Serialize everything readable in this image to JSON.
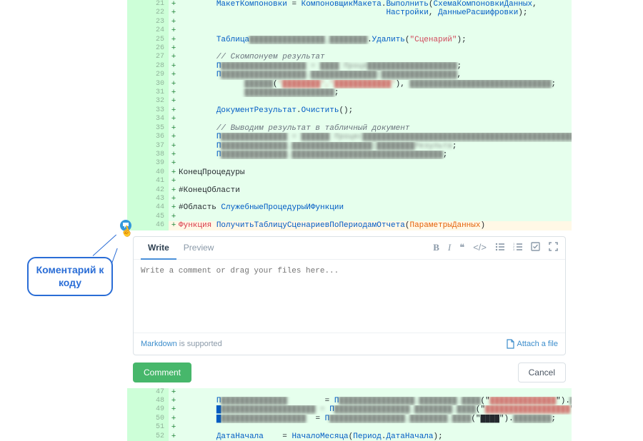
{
  "codeLines": [
    {
      "ln": 21,
      "indent": "        ",
      "tokens": [
        {
          "t": "МакетКомпоновки ",
          "c": "fn"
        },
        {
          "t": "= ",
          "c": ""
        },
        {
          "t": "КомпоновщикМакета",
          "c": "fn"
        },
        {
          "t": ".",
          "c": ""
        },
        {
          "t": "Выполнить",
          "c": "fn"
        },
        {
          "t": "(",
          "c": ""
        },
        {
          "t": "СхемаКомпоновкиДанных",
          "c": "fn"
        },
        {
          "t": ",",
          "c": ""
        }
      ]
    },
    {
      "ln": 22,
      "indent": "                                            ",
      "tokens": [
        {
          "t": "Настройки",
          "c": "fn"
        },
        {
          "t": ", ",
          "c": ""
        },
        {
          "t": "ДанныеРасшифровки",
          "c": "fn"
        },
        {
          "t": ");",
          "c": ""
        }
      ]
    },
    {
      "ln": 23,
      "indent": "",
      "tokens": []
    },
    {
      "ln": 24,
      "indent": "",
      "tokens": []
    },
    {
      "ln": 25,
      "indent": "        ",
      "tokens": [
        {
          "t": "Таблица",
          "c": "fn"
        },
        {
          "t": "████████████████_████████",
          "c": "blur"
        },
        {
          "t": ".",
          "c": ""
        },
        {
          "t": "Удалить",
          "c": "fn"
        },
        {
          "t": "(",
          "c": ""
        },
        {
          "t": "\"Сценарий\"",
          "c": "str"
        },
        {
          "t": ");",
          "c": ""
        }
      ]
    },
    {
      "ln": 26,
      "indent": "",
      "tokens": []
    },
    {
      "ln": 27,
      "indent": "        ",
      "tokens": [
        {
          "t": "// Скомпонуем результат",
          "c": "cmt"
        }
      ]
    },
    {
      "ln": 28,
      "indent": "        ",
      "tokens": [
        {
          "t": "П",
          "c": "fn"
        },
        {
          "t": "██████████████████ = ████ Проце███████████████████",
          "c": "blur"
        },
        {
          "t": ";",
          "c": ""
        }
      ]
    },
    {
      "ln": 29,
      "indent": "        ",
      "tokens": [
        {
          "t": "П",
          "c": "fn"
        },
        {
          "t": "██████████████████.██████████████(████████████████",
          "c": "blur"
        },
        {
          "t": ",",
          "c": ""
        }
      ]
    },
    {
      "ln": 30,
      "indent": "              ",
      "tokens": [
        {
          "t": "██████",
          "c": "blur"
        },
        {
          "t": "(",
          "c": ""
        },
        {
          "t": "\"████████\",\"████████████\"",
          "c": "blur-red"
        },
        {
          "t": "), ",
          "c": ""
        },
        {
          "t": "██████████████████████████████",
          "c": "blur"
        },
        {
          "t": ";",
          "c": ""
        }
      ]
    },
    {
      "ln": 31,
      "indent": "              ",
      "tokens": [
        {
          "t": "███████████████████",
          "c": "blur"
        },
        {
          "t": ";",
          "c": ""
        }
      ]
    },
    {
      "ln": 32,
      "indent": "",
      "tokens": []
    },
    {
      "ln": 33,
      "indent": "        ",
      "tokens": [
        {
          "t": "ДокументРезультат",
          "c": "fn"
        },
        {
          "t": ".",
          "c": ""
        },
        {
          "t": "Очистить",
          "c": "fn"
        },
        {
          "t": "();",
          "c": ""
        }
      ]
    },
    {
      "ln": 34,
      "indent": "",
      "tokens": []
    },
    {
      "ln": 35,
      "indent": "        ",
      "tokens": [
        {
          "t": "// Выводим результат в табличный документ",
          "c": "cmt"
        }
      ]
    },
    {
      "ln": 36,
      "indent": "        ",
      "tokens": [
        {
          "t": "П",
          "c": "fn"
        },
        {
          "t": "██████████████ = ██████ Процес██████████████████████████████████████████████████████████",
          "c": "blur"
        },
        {
          "t": ";",
          "c": ""
        }
      ]
    },
    {
      "ln": 37,
      "indent": "        ",
      "tokens": [
        {
          "t": "П",
          "c": "fn"
        },
        {
          "t": "██████████████.█████████████████(████████Результа",
          "c": "blur"
        },
        {
          "t": ";",
          "c": ""
        }
      ]
    },
    {
      "ln": 38,
      "indent": "        ",
      "tokens": [
        {
          "t": "П",
          "c": "fn"
        },
        {
          "t": "██████████████.████████████████████████████████",
          "c": "blur"
        },
        {
          "t": ";",
          "c": ""
        }
      ]
    },
    {
      "ln": 39,
      "indent": "",
      "tokens": []
    },
    {
      "ln": 40,
      "indent": "",
      "tokens": [
        {
          "t": "КонецПроцедуры",
          "c": ""
        }
      ]
    },
    {
      "ln": 41,
      "indent": "",
      "tokens": []
    },
    {
      "ln": 42,
      "indent": "",
      "tokens": [
        {
          "t": "#КонецОбласти",
          "c": ""
        }
      ]
    },
    {
      "ln": 43,
      "indent": "",
      "tokens": []
    },
    {
      "ln": 44,
      "indent": "",
      "tokens": [
        {
          "t": "#Область ",
          "c": ""
        },
        {
          "t": "СлужебныеПроцедурыИФункции",
          "c": "fn"
        }
      ]
    },
    {
      "ln": 45,
      "indent": "",
      "tokens": []
    },
    {
      "ln": 46,
      "hl": true,
      "indent": "",
      "tokens": [
        {
          "t": "Функция ",
          "c": "kw"
        },
        {
          "t": "ПолучитьТаблицуСценариевПоПериодамОтчета",
          "c": "fn"
        },
        {
          "t": "(",
          "c": ""
        },
        {
          "t": "ПараметрыДанных",
          "c": "param"
        },
        {
          "t": ")",
          "c": ""
        }
      ]
    }
  ],
  "codeLinesBottom": [
    {
      "ln": 47,
      "indent": "",
      "tokens": []
    },
    {
      "ln": 48,
      "indent": "        ",
      "tokens": [
        {
          "t": "П",
          "c": "fn"
        },
        {
          "t": "██████████████",
          "c": "blur"
        },
        {
          "t": "        = ",
          "c": ""
        },
        {
          "t": "П",
          "c": "fn"
        },
        {
          "t": "████████████████.████████.████",
          "c": "blur"
        },
        {
          "t": "(\"",
          "c": ""
        },
        {
          "t": "██████████████",
          "c": "blur-red"
        },
        {
          "t": "\").",
          "c": ""
        },
        {
          "t": "████████",
          "c": "blur"
        },
        {
          "t": ";",
          "c": ""
        }
      ]
    },
    {
      "ln": 49,
      "indent": "        ",
      "tokens": [
        {
          "t": "█",
          "c": "fn"
        },
        {
          "t": "████████████████████ = ",
          "c": "blur"
        },
        {
          "t": "П",
          "c": "fn"
        },
        {
          "t": "████████████████.████████.████",
          "c": "blur"
        },
        {
          "t": "(\"",
          "c": ""
        },
        {
          "t": "██████████████████",
          "c": "blur-red"
        },
        {
          "t": "\").",
          "c": ""
        },
        {
          "t": "████████",
          "c": "blur"
        },
        {
          "t": ".",
          "c": ""
        },
        {
          "t": "████████████████",
          "c": "blur-blue"
        },
        {
          "t": ";",
          "c": ""
        }
      ]
    },
    {
      "ln": 50,
      "indent": "        ",
      "tokens": [
        {
          "t": "█",
          "c": "fn"
        },
        {
          "t": "██████████████████",
          "c": "blur"
        },
        {
          "t": "  = ",
          "c": ""
        },
        {
          "t": "П",
          "c": "fn"
        },
        {
          "t": "████████████████.████████.████",
          "c": "blur"
        },
        {
          "t": "(\"████\").",
          "c": ""
        },
        {
          "t": "████████",
          "c": "blur"
        },
        {
          "t": ";",
          "c": ""
        }
      ]
    },
    {
      "ln": 51,
      "indent": "",
      "tokens": []
    },
    {
      "ln": 52,
      "indent": "        ",
      "tokens": [
        {
          "t": "ДатаНачала",
          "c": "fn"
        },
        {
          "t": "    = ",
          "c": ""
        },
        {
          "t": "НачалоМесяца",
          "c": "fn"
        },
        {
          "t": "(",
          "c": ""
        },
        {
          "t": "Период",
          "c": "fn"
        },
        {
          "t": ".",
          "c": ""
        },
        {
          "t": "ДатаНачала",
          "c": "fn"
        },
        {
          "t": ");",
          "c": ""
        }
      ]
    }
  ],
  "callout": {
    "text": "Коментарий к коду"
  },
  "commentBox": {
    "tabs": {
      "write": "Write",
      "preview": "Preview"
    },
    "placeholder": "Write a comment or drag your files here...",
    "markdownLink": "Markdown",
    "markdownSupported": " is supported",
    "attach": "Attach a file",
    "buttons": {
      "comment": "Comment",
      "cancel": "Cancel"
    }
  },
  "marker": "+"
}
